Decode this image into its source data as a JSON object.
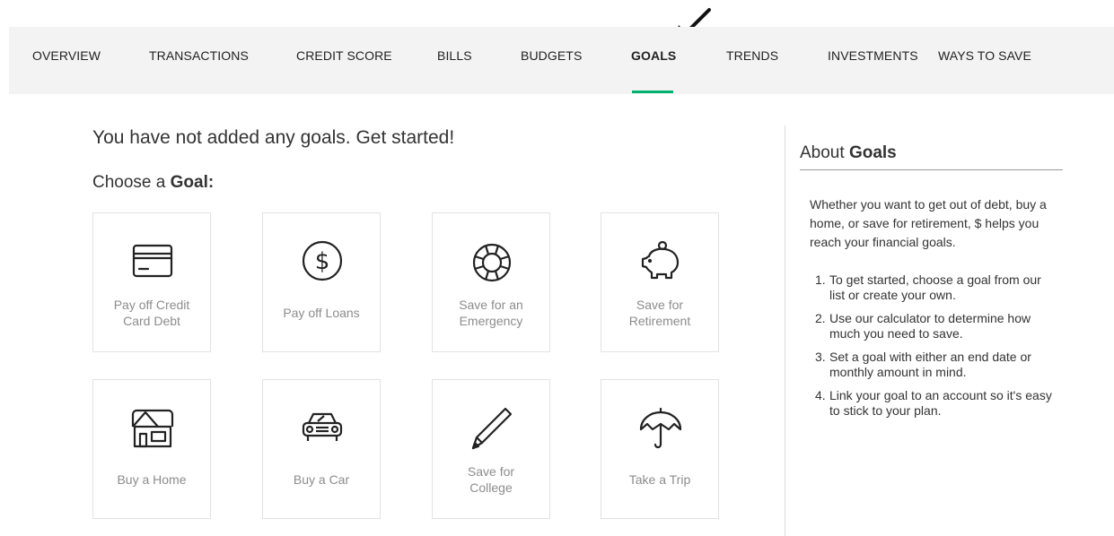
{
  "nav": {
    "items": [
      {
        "label": "OVERVIEW",
        "active": false
      },
      {
        "label": "TRANSACTIONS",
        "active": false
      },
      {
        "label": "CREDIT SCORE",
        "active": false
      },
      {
        "label": "BILLS",
        "active": false
      },
      {
        "label": "BUDGETS",
        "active": false
      },
      {
        "label": "GOALS",
        "active": true
      },
      {
        "label": "TRENDS",
        "active": false
      },
      {
        "label": "INVESTMENTS",
        "active": false
      },
      {
        "label": "WAYS TO SAVE",
        "active": false
      }
    ],
    "active_color": "#00b26f"
  },
  "main": {
    "empty_message": "You have not added any goals. Get started!",
    "choose_prefix": "Choose a",
    "choose_bold": "Goal:",
    "goals": [
      {
        "label": "Pay off Credit Card Debt",
        "line1": "Pay off Credit",
        "line2": "Card Debt",
        "icon": "credit-card-icon"
      },
      {
        "label": "Pay off Loans",
        "line1": "Pay off Loans",
        "line2": "",
        "icon": "dollar-coin-icon"
      },
      {
        "label": "Save for an Emergency",
        "line1": "Save for an",
        "line2": "Emergency",
        "icon": "life-ring-icon"
      },
      {
        "label": "Save for Retirement",
        "line1": "Save for",
        "line2": "Retirement",
        "icon": "piggy-bank-icon"
      },
      {
        "label": "Buy a Home",
        "line1": "Buy a Home",
        "line2": "",
        "icon": "house-icon"
      },
      {
        "label": "Buy a Car",
        "line1": "Buy a Car",
        "line2": "",
        "icon": "car-icon"
      },
      {
        "label": "Save for College",
        "line1": "Save for",
        "line2": "College",
        "icon": "pencil-icon"
      },
      {
        "label": "Take a Trip",
        "line1": "Take a Trip",
        "line2": "",
        "icon": "umbrella-icon"
      }
    ]
  },
  "sidebar": {
    "title_prefix": "About",
    "title_bold": "Goals",
    "description": "Whether you want to get out of debt, buy a home, or save for retirement, $ helps you reach your financial goals.",
    "steps": [
      "To get started, choose a goal from our list or create your own.",
      "Use our calculator to determine how much you need to save.",
      "Set a goal with either an end date or monthly amount in mind.",
      "Link your goal to an account so it's easy to stick to your plan."
    ]
  }
}
